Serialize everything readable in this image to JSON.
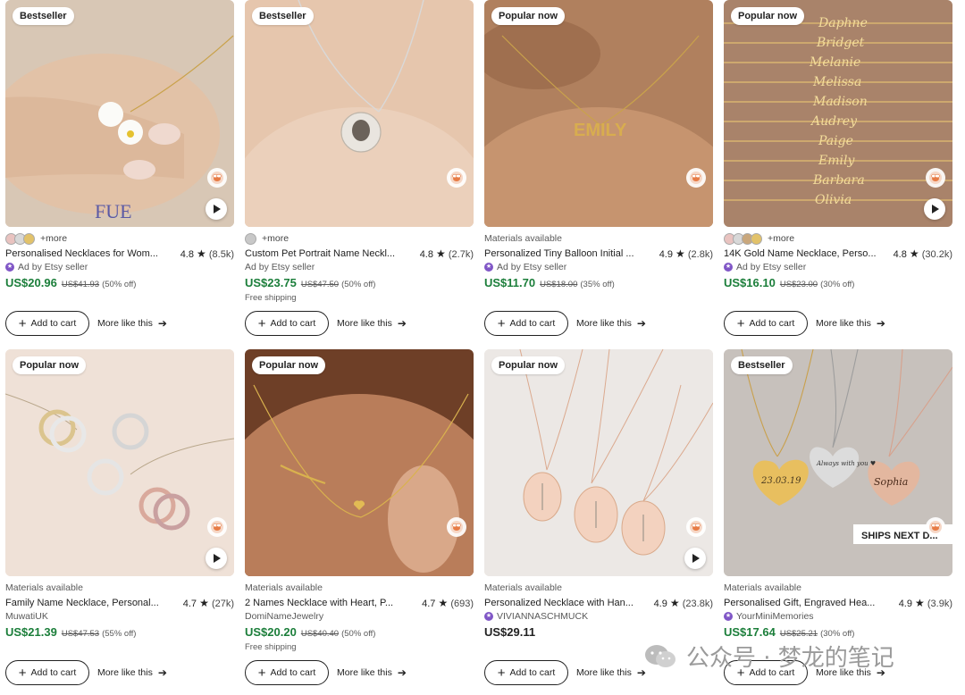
{
  "actions": {
    "add_to_cart": "Add to cart",
    "more_like_this": "More like this"
  },
  "icons": {
    "favorite": "bee-favorite-icon",
    "play": "play-icon",
    "star": "star-icon",
    "arrow": "arrow-right-icon",
    "plus": "plus-icon"
  },
  "colors": {
    "sale_price": "#1b7e3a",
    "star_seller": "#7f55c6"
  },
  "products": [
    {
      "badge": "Bestseller",
      "more": "+more",
      "materials": "",
      "title": "Personalised Necklaces for Wom...",
      "rating": "4.8",
      "reviews": "(8.5k)",
      "seller": "Ad by Etsy seller",
      "price": "US$20.96",
      "original_price": "US$41.93",
      "discount": "(50% off)",
      "shipping": "",
      "has_video": true,
      "swatch_colors": [
        "#e9c3c0",
        "#d8d8d8",
        "#e2c26a"
      ],
      "photo_text": "FUE"
    },
    {
      "badge": "Bestseller",
      "more": "+more",
      "materials": "",
      "title": "Custom Pet Portrait Name Neckl...",
      "rating": "4.8",
      "reviews": "(2.7k)",
      "seller": "Ad by Etsy seller",
      "price": "US$23.75",
      "original_price": "US$47.50",
      "discount": "(50% off)",
      "shipping": "Free shipping",
      "has_video": false,
      "swatch_colors": [
        "#c8c8c8"
      ],
      "photo_text": ""
    },
    {
      "badge": "Popular now",
      "more": "",
      "materials": "Materials available",
      "title": "Personalized Tiny Balloon Initial ...",
      "rating": "4.9",
      "reviews": "(2.8k)",
      "seller": "Ad by Etsy seller",
      "price": "US$11.70",
      "original_price": "US$18.00",
      "discount": "(35% off)",
      "shipping": "",
      "has_video": false,
      "swatch_colors": [],
      "photo_text": "EMILY"
    },
    {
      "badge": "Popular now",
      "more": "+more",
      "materials": "",
      "title": "14K Gold Name Necklace, Perso...",
      "rating": "4.8",
      "reviews": "(30.2k)",
      "seller": "Ad by Etsy seller",
      "price": "US$16.10",
      "original_price": "US$23.00",
      "discount": "(30% off)",
      "shipping": "",
      "has_video": true,
      "swatch_colors": [
        "#e9c3c0",
        "#d8d8d8",
        "#c9a77c",
        "#e2c26a"
      ],
      "name_list": [
        "Daphne",
        "Bridget",
        "Melanie",
        "Melissa",
        "Madison",
        "Audrey",
        "Paige",
        "Emily",
        "Barbara",
        "Olivia"
      ]
    },
    {
      "badge": "Popular now",
      "more": "",
      "materials": "Materials available",
      "title": "Family Name Necklace, Personal...",
      "rating": "4.7",
      "reviews": "(27k)",
      "seller": "MuwatiUK",
      "price": "US$21.39",
      "original_price": "US$47.53",
      "discount": "(55% off)",
      "shipping": "",
      "has_video": true,
      "swatch_colors": [],
      "photo_text": ""
    },
    {
      "badge": "Popular now",
      "more": "",
      "materials": "Materials available",
      "title": "2 Names Necklace with Heart, P...",
      "rating": "4.7",
      "reviews": "(693)",
      "seller": "DomiNameJewelry",
      "price": "US$20.20",
      "original_price": "US$40.40",
      "discount": "(50% off)",
      "shipping": "Free shipping",
      "has_video": false,
      "swatch_colors": [],
      "photo_text": ""
    },
    {
      "badge": "Popular now",
      "more": "",
      "materials": "Materials available",
      "title": "Personalized Necklace with Han...",
      "rating": "4.9",
      "reviews": "(23.8k)",
      "seller": "VIVIANNASCHMUCK",
      "price": "US$29.11",
      "original_price": "",
      "discount": "",
      "shipping": "",
      "has_video": true,
      "swatch_colors": [],
      "photo_text": ""
    },
    {
      "badge": "Bestseller",
      "more": "",
      "materials": "Materials available",
      "title": "Personalised Gift, Engraved Hea...",
      "rating": "4.9",
      "reviews": "(3.9k)",
      "seller": "YourMiniMemories",
      "price": "US$17.64",
      "original_price": "US$25.21",
      "discount": "(30% off)",
      "shipping": "",
      "has_video": false,
      "swatch_colors": [],
      "photo_text": "SHIPS NEXT D...",
      "heart_texts": [
        "23.03.19",
        "Always with you ♥",
        "Sophia"
      ]
    }
  ],
  "watermark": {
    "text": "公众号 · 梦龙的笔记"
  }
}
